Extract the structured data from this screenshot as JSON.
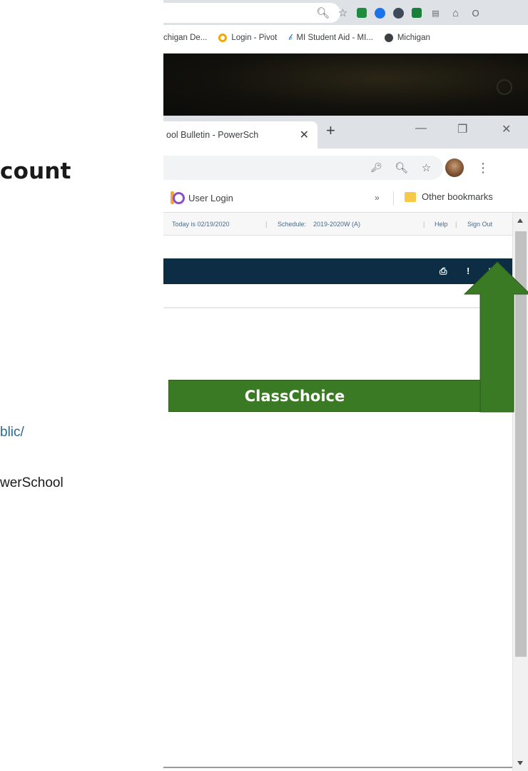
{
  "slide": {
    "heading": "count",
    "link_text": "blic/",
    "body_text": "werSchool"
  },
  "back_browser": {
    "bookmarks": [
      {
        "label": "chigan De..."
      },
      {
        "label": "Login - Pivot"
      },
      {
        "label": "MI Student Aid - MI..."
      },
      {
        "label": "Michigan"
      }
    ]
  },
  "front_browser": {
    "tab_title": "ool Bulletin - PowerSch",
    "bookmarks": {
      "user_login": "User Login",
      "more": "»",
      "other": "Other bookmarks"
    }
  },
  "powerschool": {
    "today": "Today is 02/19/2020",
    "schedule_label": "Schedule:",
    "schedule_value": "2019-2020W (A)",
    "help": "Help",
    "sign_out": "Sign Out"
  },
  "callout": {
    "label": "ClassChoice",
    "color": "#3b7a24"
  }
}
